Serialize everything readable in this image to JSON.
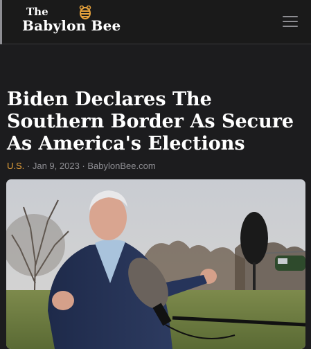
{
  "header": {
    "logo_the": "The",
    "logo_name": "Babylon Bee",
    "brand_color": "#e8a33c",
    "menu_icon": "hamburger-menu-icon"
  },
  "article": {
    "headline": "Biden Declares The Southern Border As Secure As America's Elections",
    "category": "U.S.",
    "separator_1": " · ",
    "date": "Jan 9, 2023",
    "separator_2": " · ",
    "source": "BabylonBee.com",
    "category_color": "#e8a33c"
  }
}
